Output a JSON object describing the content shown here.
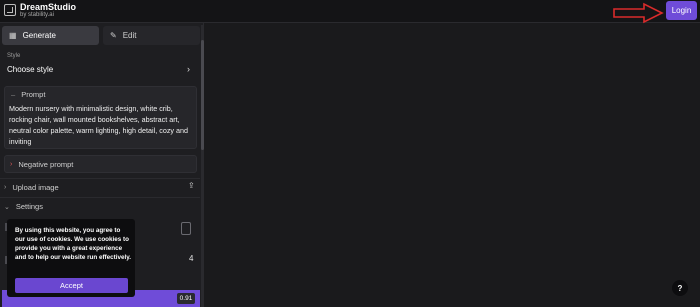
{
  "brand": {
    "name": "DreamStudio",
    "subtitle": "by stability.ai"
  },
  "header": {
    "login_label": "Login"
  },
  "tabs": [
    {
      "label": "Generate",
      "icon": "grid-icon",
      "active": true
    },
    {
      "label": "Edit",
      "icon": "edit-icon",
      "active": false
    }
  ],
  "style": {
    "caption": "Style",
    "value": "Choose style",
    "chevron": "›"
  },
  "prompt": {
    "label": "Prompt",
    "text": "Modern nursery with minimalistic design, white crib, rocking chair, wall mounted bookshelves, abstract art, neutral color palette, warm lighting, high detail, cozy and inviting"
  },
  "negative_prompt": {
    "label": "Negative prompt"
  },
  "upload": {
    "label": "Upload image"
  },
  "settings": {
    "label": "Settings",
    "value_a": "4",
    "value_b": "0.91"
  },
  "cookie": {
    "text": "By using this website, you agree to our use of cookies. We use cookies to provide you with a great experience and to help our website run effectively.",
    "accept_label": "Accept"
  },
  "help": {
    "label": "?"
  },
  "colors": {
    "accent": "#6f4cd8",
    "arrow": "#d92b2b"
  }
}
